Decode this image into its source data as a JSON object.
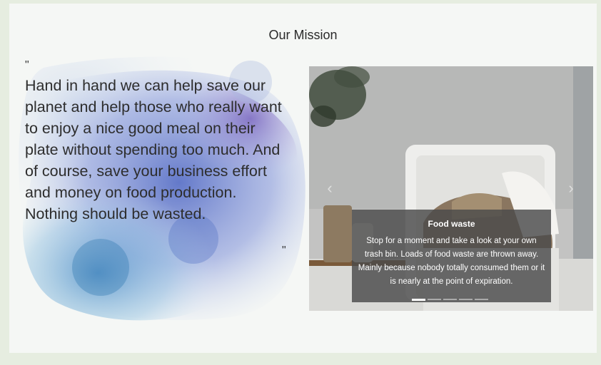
{
  "section": {
    "title": "Our Mission"
  },
  "quote": {
    "open_mark": "\"",
    "text": "Hand in hand we can help save our planet and help those who really want to enjoy a nice good meal on their plate without spending too much. And of course, save your business effort and money on food production. Nothing should be wasted.",
    "close_mark": "\""
  },
  "carousel": {
    "prev_icon": "chevron-left-icon",
    "next_icon": "chevron-right-icon",
    "prev_glyph": "‹",
    "next_glyph": "›",
    "slides": [
      {
        "title": "Food waste",
        "body": "Stop for a moment and take a look at your own trash bin. Loads of food waste are thrown away. Mainly because nobody totally consumed them or it is nearly at the point of expiration."
      }
    ],
    "indicator_count": 5,
    "active_index": 0
  },
  "colors": {
    "page_bg": "#e6ede0",
    "panel_bg": "#f5f7f5",
    "splash_blue": "#5a78c8",
    "splash_purple": "#6a5ab8",
    "splash_teal": "#5aa6c8",
    "caption_bg": "#4b4b4b"
  }
}
